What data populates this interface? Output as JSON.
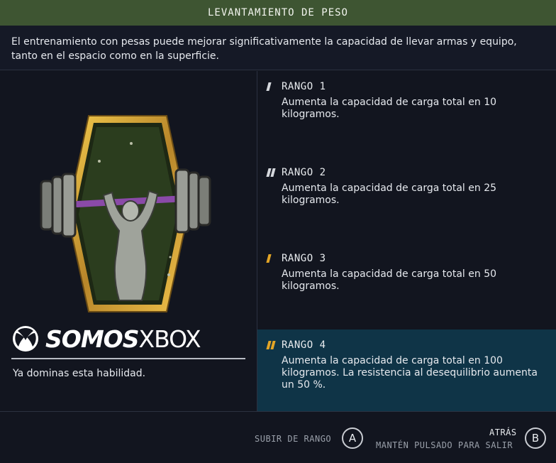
{
  "header": {
    "title": "LEVANTAMIENTO DE PESO"
  },
  "description": "El entrenamiento con pesas puede mejorar significativamente la capacidad de llevar armas y equipo, tanto en el espacio como en la superficie.",
  "watermark": {
    "brand_bold": "SOMOS",
    "brand_rest": "XBOX",
    "icon": "xbox-logo-icon"
  },
  "status": "Ya dominas esta habilidad.",
  "ranks": [
    {
      "title": "RANGO 1",
      "text": "Aumenta la capacidad de carga total en 10 kilogramos.",
      "pips": 1,
      "active": false
    },
    {
      "title": "RANGO 2",
      "text": "Aumenta la capacidad de carga total en 25 kilogramos.",
      "pips": 2,
      "active": false
    },
    {
      "title": "RANGO 3",
      "text": "Aumenta la capacidad de carga total en 50 kilogramos.",
      "pips": 1,
      "active": false
    },
    {
      "title": "RANGO 4",
      "text": "Aumenta la capacidad de carga total en 100 kilogramos. La resistencia al desequilibrio aumenta un 50 %.",
      "pips": 2,
      "active": true
    }
  ],
  "footer": {
    "rank_up_label": "SUBIR DE RANGO",
    "rank_up_key": "A",
    "back_label": "ATRÁS",
    "back_hint": "MANTÉN PULSADO PARA SALIR",
    "back_key": "B"
  },
  "colors": {
    "title_bar": "#3e5532",
    "active_rank_bg": "#0f3447",
    "pip_inactive": "#d5d8dd",
    "pip_gold": "#e3a526"
  }
}
